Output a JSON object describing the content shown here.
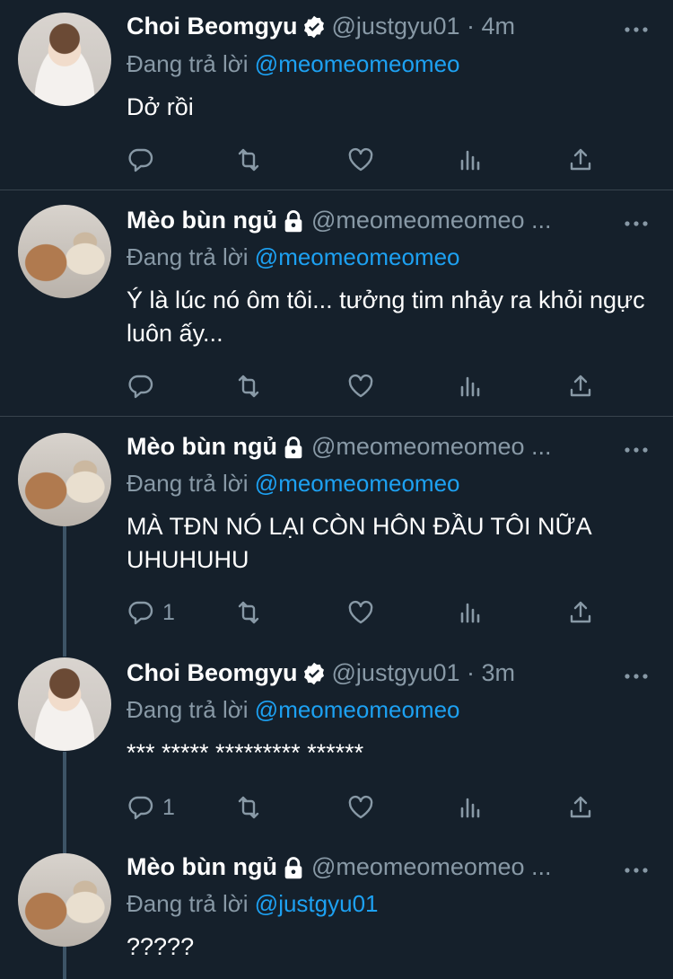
{
  "tweets": [
    {
      "name": "Choi Beomgyu",
      "handle": "@justgyu01 · 4m",
      "badge": "verified-badge",
      "avatar": "person",
      "reply_prefix": "Đang trả lời",
      "reply_to": "@meomeomeomeo",
      "text": "Dở rồi",
      "reply_count": ""
    },
    {
      "name": "Mèo bùn ngủ",
      "handle": "@meomeomeomeo ...",
      "badge": "lock-icon",
      "avatar": "cats",
      "reply_prefix": "Đang trả lời",
      "reply_to": "@meomeomeomeo",
      "text": "Ý là lúc nó ôm tôi... tưởng tim nhảy ra khỏi ngực luôn ấy...",
      "reply_count": ""
    },
    {
      "name": "Mèo bùn ngủ",
      "handle": "@meomeomeomeo ...",
      "badge": "lock-icon",
      "avatar": "cats",
      "reply_prefix": "Đang trả lời",
      "reply_to": "@meomeomeomeo",
      "text": "MÀ TĐN NÓ LẠI CÒN HÔN ĐẦU TÔI NỮA UHUHUHU",
      "reply_count": "1"
    },
    {
      "name": "Choi Beomgyu",
      "handle": "@justgyu01 · 3m",
      "badge": "verified-badge",
      "avatar": "person",
      "reply_prefix": "Đang trả lời",
      "reply_to": "@meomeomeomeo",
      "text": "*** ***** ********* ******",
      "reply_count": "1"
    },
    {
      "name": "Mèo bùn ngủ",
      "handle": "@meomeomeomeo ...",
      "badge": "lock-icon",
      "avatar": "cats",
      "reply_prefix": "Đang trả lời",
      "reply_to": "@justgyu01",
      "text": "?????",
      "reply_count": ""
    }
  ],
  "colors": {
    "background": "#15202b",
    "secondary_text": "#8899a6",
    "mention": "#1da1f2",
    "divider": "#38444d"
  }
}
